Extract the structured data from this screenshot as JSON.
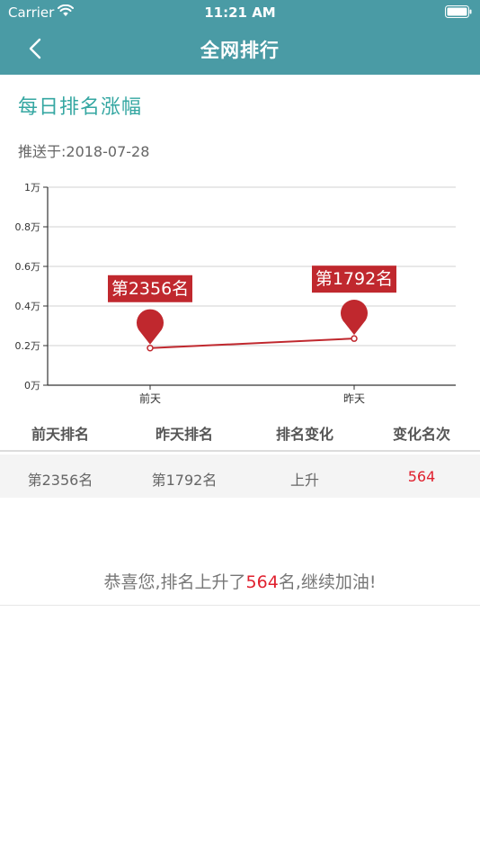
{
  "status_bar": {
    "carrier": "Carrier",
    "time": "11:21 AM"
  },
  "nav": {
    "title": "全网排行",
    "back_icon": "chevron-left-icon"
  },
  "section": {
    "title": "每日排名涨幅",
    "push_date": "推送于:2018-07-28"
  },
  "chart_data": {
    "type": "line",
    "categories": [
      "前天",
      "昨天"
    ],
    "values": [
      1874,
      2356
    ],
    "annotations": [
      "第2356名",
      "第1792名"
    ],
    "yticks": [
      "0万",
      "0.2万",
      "0.4万",
      "0.6万",
      "0.8万",
      "1万"
    ],
    "ylim": [
      0,
      10000
    ],
    "grid": true,
    "line_color": "#c0282e"
  },
  "table": {
    "headers": [
      "前天排名",
      "昨天排名",
      "排名变化",
      "变化名次"
    ],
    "row": [
      "第2356名",
      "第1792名",
      "上升",
      "564"
    ]
  },
  "congrats": {
    "prefix": "恭喜您,排名上升了",
    "number": "564",
    "suffix": "名,继续加油!"
  },
  "colors": {
    "header": "#4a9ba5",
    "accent": "#35a7a2",
    "red": "#c0282e",
    "highlight": "#e0202e"
  }
}
